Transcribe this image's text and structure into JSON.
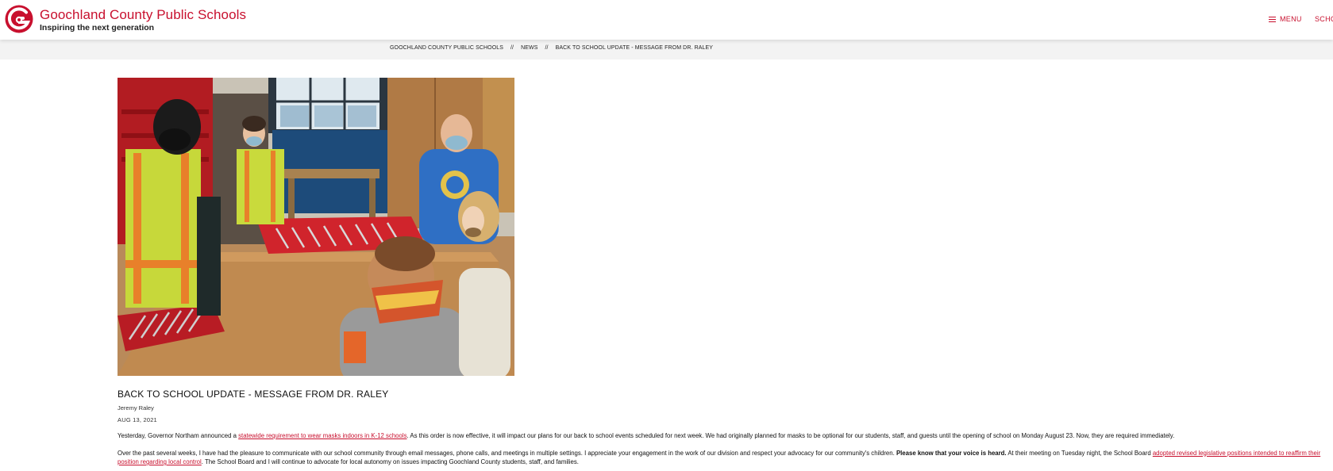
{
  "header": {
    "site_title": "Goochland County Public Schools",
    "tagline": "Inspiring the next generation",
    "menu_label": "MENU",
    "schools_label": "SCHC",
    "brand_color": "#c8102e"
  },
  "breadcrumb": {
    "items": [
      "GOOCHLAND COUNTY PUBLIC SCHOOLS",
      "NEWS",
      "BACK TO SCHOOL UPDATE - MESSAGE FROM DR. RALEY"
    ],
    "separator": "//"
  },
  "article": {
    "title": "BACK TO SCHOOL UPDATE - MESSAGE FROM DR. RALEY",
    "author": "Jeremy Raley",
    "date": "AUG 13, 2021",
    "p1": {
      "before": "Yesterday, Governor Northam announced a ",
      "link": "statewide requirement to wear masks indoors in K-12 schools",
      "after": ".  As this order is now effective, it will impact our plans for our back to school events scheduled for next week.  We had originally planned for masks to be optional for our students, staff, and guests until the opening of school on Monday August 23. Now, they are required immediately."
    },
    "p2": {
      "before": "Over the past several weeks, I have had the pleasure to communicate with our school community through email messages, phone calls, and meetings in multiple settings.  I appreciate your engagement in the work of our division and respect your advocacy for our community's children.  ",
      "bold": "Please know that your voice is heard.",
      "middle": "  At their meeting on Tuesday night, the School Board ",
      "link": "adopted revised legislative positions intended to reaffirm their position regarding local control",
      "after": ".  The School Board and I will continue to advocate for local autonomy on issues impacting Goochland County students, staff, and families."
    }
  },
  "icons": {
    "logo": "goochland-g-logo-icon",
    "menu": "hamburger-icon"
  }
}
